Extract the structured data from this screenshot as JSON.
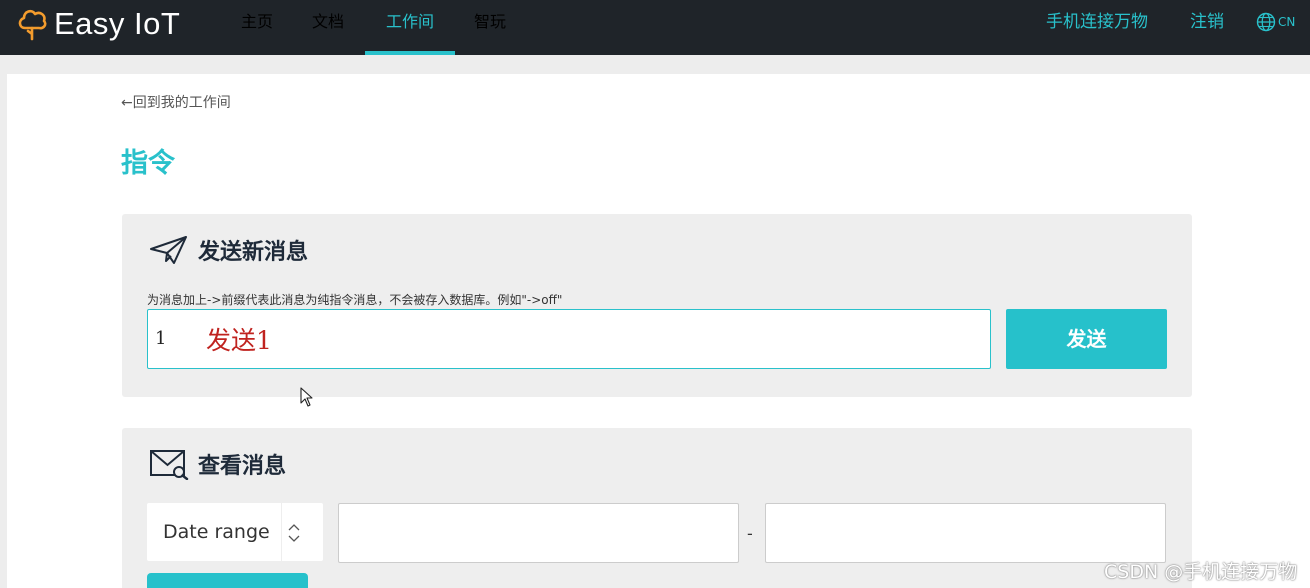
{
  "app": {
    "logo_text": "Easy IoT"
  },
  "nav": {
    "items": [
      {
        "label": "主页",
        "active": false
      },
      {
        "label": "文档",
        "active": false
      },
      {
        "label": "工作间",
        "active": true
      },
      {
        "label": "智玩",
        "active": false
      }
    ],
    "right": {
      "connect": "手机连接万物",
      "logout": "注销",
      "lang": "CN"
    }
  },
  "page": {
    "back_link": "←回到我的工作间",
    "title": "指令"
  },
  "send_card": {
    "title": "发送新消息",
    "icon": "paper-plane-icon",
    "hint": "为消息加上->前缀代表此消息为纯指令消息，不会被存入数据库。例如\"->off\"",
    "input_value": "1",
    "annotation": "发送1",
    "send_label": "发送"
  },
  "view_card": {
    "title": "查看消息",
    "icon": "mail-search-icon",
    "select_value": "Date range",
    "date_separator": "-"
  },
  "watermark": "CSDN @手机连接万物",
  "colors": {
    "accent": "#29c1cb",
    "nav_bg": "#1f2429",
    "annotation": "#c0231f"
  }
}
